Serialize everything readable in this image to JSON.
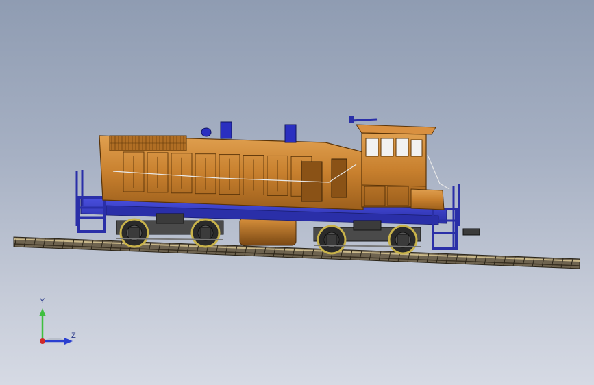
{
  "viewport": {
    "background_top": "#8f9cb2",
    "background_bottom": "#d6dae4"
  },
  "model": {
    "body_color": "#c8802e",
    "frame_color": "#3a3fd0",
    "truck_color": "#3b3b3b",
    "wheel_rim_color": "#c9b34a"
  },
  "triad": {
    "y_label": "Y",
    "z_label": "Z",
    "y_color": "#3fbf3f",
    "z_color": "#2a3fd0",
    "x_color": "#d02a2a"
  }
}
